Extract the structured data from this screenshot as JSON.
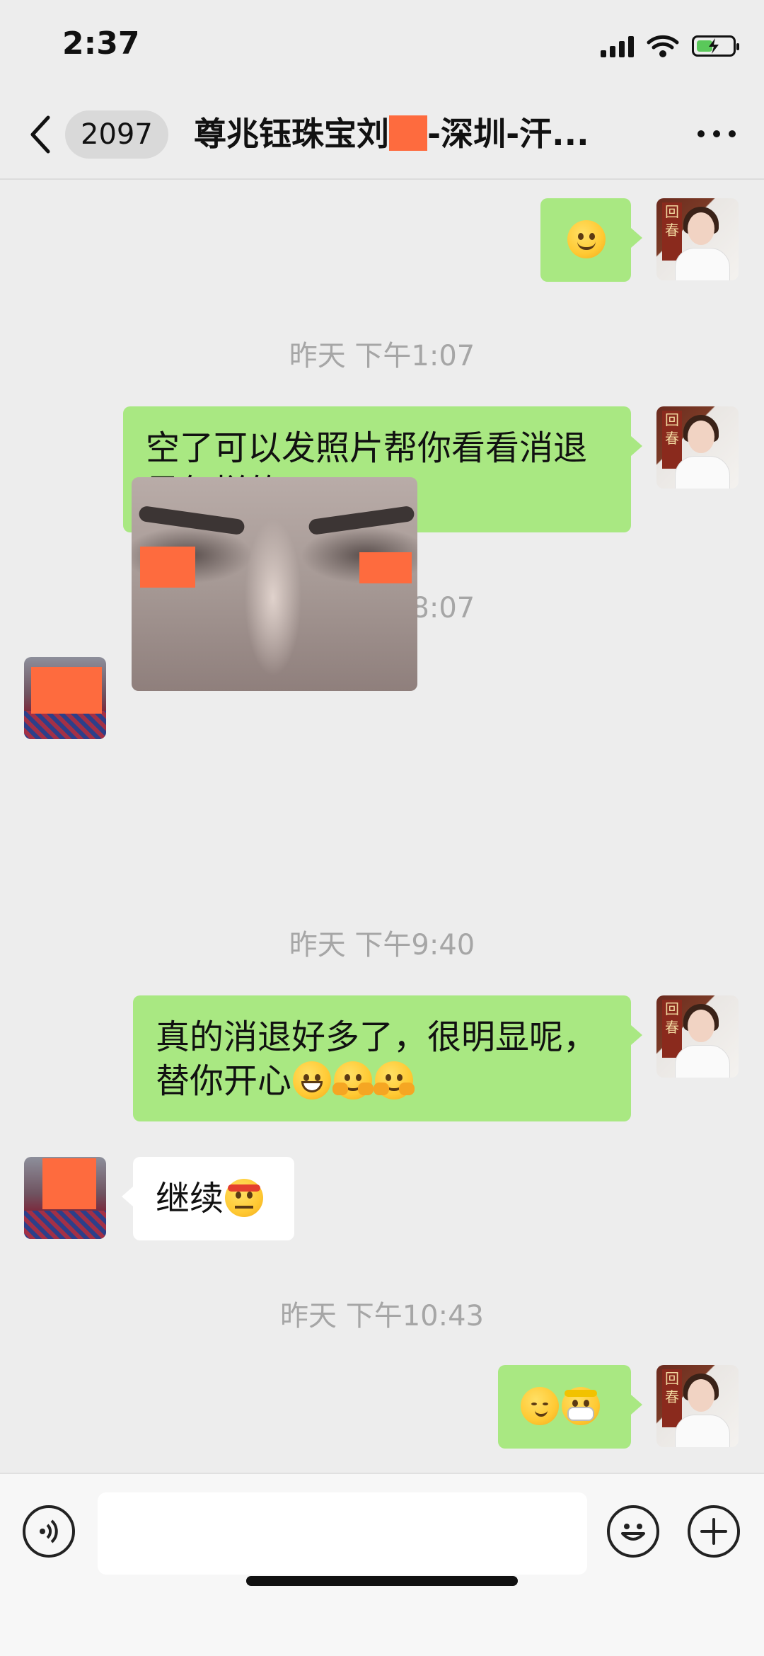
{
  "status_bar": {
    "time": "2:37"
  },
  "header": {
    "unread_count": "2097",
    "title_prefix": "尊兆钰珠宝刘",
    "title_suffix": "-深圳-汗..."
  },
  "messages": [
    {
      "type": "emoji",
      "side": "right",
      "emoji": "smiling-face"
    },
    {
      "type": "timestamp",
      "text": "昨天 下午1:07"
    },
    {
      "type": "text",
      "side": "right",
      "text": "空了可以发照片帮你看看消退是怎样的了"
    },
    {
      "type": "timestamp",
      "text": "昨天 下午8:07"
    },
    {
      "type": "image",
      "side": "left",
      "description": "eye area photo"
    },
    {
      "type": "timestamp",
      "text": "昨天 下午9:40"
    },
    {
      "type": "text",
      "side": "right",
      "text": "真的消退好多了，很明显呢，替你开心",
      "emojis": [
        "grinning-face",
        "hugging-face",
        "hugging-face"
      ]
    },
    {
      "type": "text",
      "side": "left",
      "text": "继续",
      "emojis": [
        "determined-face"
      ]
    },
    {
      "type": "timestamp",
      "text": "昨天 下午10:43"
    },
    {
      "type": "emoji",
      "side": "right",
      "emojis": [
        "sly-face",
        "face-with-medical-mask"
      ]
    }
  ],
  "input_bar": {
    "value": ""
  },
  "colors": {
    "my_bubble": "#a9e882",
    "their_bubble": "#ffffff",
    "redaction": "#fe6b3e",
    "background": "#ededed"
  }
}
